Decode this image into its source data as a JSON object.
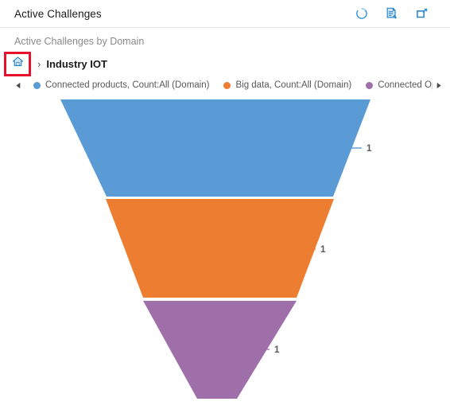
{
  "header": {
    "title": "Active Challenges",
    "actions": [
      {
        "name": "refresh-icon",
        "label": "Refresh"
      },
      {
        "name": "export-report-icon",
        "label": "Export report"
      },
      {
        "name": "popout-icon",
        "label": "Open in new window"
      }
    ]
  },
  "chart": {
    "title": "Active Challenges by Domain",
    "breadcrumb": {
      "home_label": "Home",
      "separator": "›",
      "current": "Industry IOT",
      "highlight_color": "#e8112d"
    },
    "legend": {
      "prev_label": "◀",
      "next_label": "▶",
      "items": [
        {
          "label": "Connected products, Count:All (Domain)",
          "color": "#5B9BD5"
        },
        {
          "label": "Big data, Count:All (Domain)",
          "color": "#ED7D31"
        },
        {
          "label": "Connected Opera",
          "color": "#9E6FA9"
        }
      ]
    }
  },
  "chart_data": {
    "type": "funnel",
    "title": "Active Challenges by Domain",
    "xlabel": "",
    "ylabel": "",
    "categories": [
      "Connected products, Count:All (Domain)",
      "Big data, Count:All (Domain)",
      "Connected Opera"
    ],
    "values": [
      1,
      1,
      1
    ],
    "value_labels": [
      "1",
      "1",
      "1"
    ],
    "colors": [
      "#5B9BD5",
      "#ED7D31",
      "#9E6FA9"
    ],
    "legend_position": "top",
    "grid": false,
    "series": [
      {
        "name": "Connected products, Count:All (Domain)",
        "values": [
          1
        ]
      },
      {
        "name": "Big data, Count:All (Domain)",
        "values": [
          1
        ]
      },
      {
        "name": "Connected Opera",
        "values": [
          1
        ]
      }
    ]
  }
}
